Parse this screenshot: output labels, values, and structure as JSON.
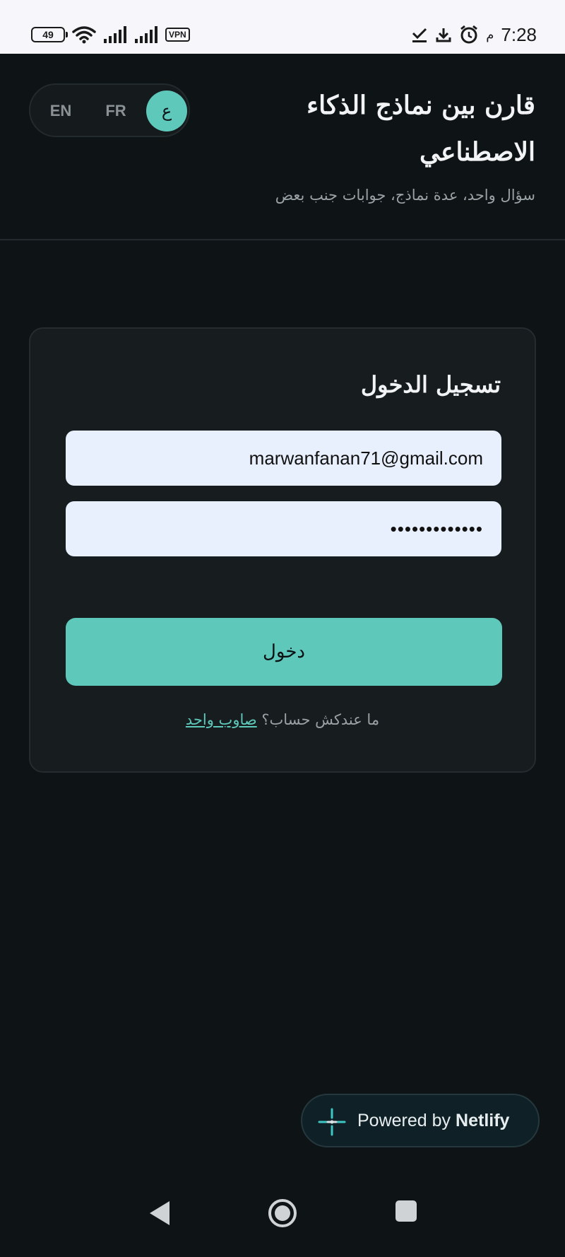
{
  "status_bar": {
    "battery": "49",
    "vpn": "VPN",
    "ampm": "م",
    "time": "7:28"
  },
  "header": {
    "languages": [
      "EN",
      "FR",
      "ع"
    ],
    "active_language": "ع",
    "title": "قارن بين نماذج الذكاء الاصطناعي",
    "subtitle": "سؤال واحد، عدة نماذج، جوابات جنب بعض"
  },
  "login": {
    "title": "تسجيل الدخول",
    "email_value": "marwanfanan71@gmail.com",
    "password_value": "•••••••••••••",
    "submit_label": "دخول",
    "signup_prompt": "ما عندكش حساب؟",
    "signup_link": "صاوب واحد"
  },
  "netlify": {
    "prefix": "Powered by",
    "brand": "Netlify"
  },
  "colors": {
    "background": "#0e1315",
    "card": "#171c1f",
    "accent": "#5ec8bb",
    "input_bg": "#e8effd"
  }
}
